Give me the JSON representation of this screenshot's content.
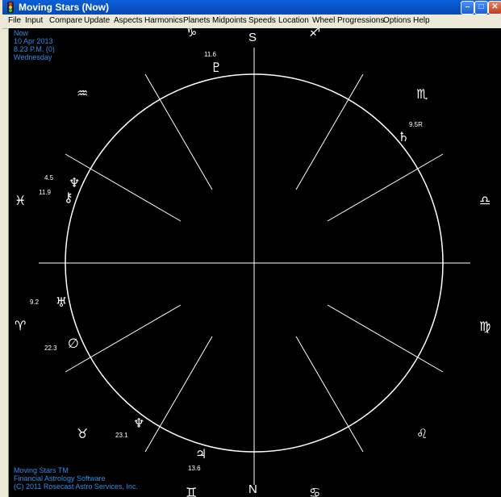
{
  "window": {
    "title": "Moving Stars (Now)",
    "minimize": "–",
    "maximize": "□",
    "close": "✕"
  },
  "menu": [
    "File",
    "Input",
    "Compare",
    "Update",
    "Aspects",
    "Harmonics",
    "Planets",
    "Midpoints",
    "Speeds",
    "Location",
    "Wheel",
    "Progressions",
    "Options",
    "Help"
  ],
  "info": {
    "line1": "Now",
    "line2": "10 Apr 2013",
    "line3": "8.23 P.M. (0)",
    "line4": "Wednesday"
  },
  "footer": {
    "line1": "Moving Stars TM",
    "line2": "Financial Astrology Software",
    "line3": "(C) 2011 Rosecast Astro Services, Inc."
  },
  "compass": {
    "top": "S",
    "bottom": "N"
  },
  "zodiac": {
    "capricorn": "♑",
    "sagittarius": "♐",
    "aquarius": "♒",
    "scorpio": "♏",
    "pisces": "♓",
    "libra": "♎",
    "aries": "♈",
    "virgo": "♍",
    "taurus": "♉",
    "leo": "♌",
    "gemini": "♊",
    "cancer": "♋"
  },
  "planets": {
    "pluto": {
      "glyph": "♇",
      "value": "11.6"
    },
    "saturn": {
      "glyph": "♄",
      "value": "9.5R"
    },
    "neptune": {
      "glyph": "♆",
      "value": "4.5"
    },
    "chiron": {
      "glyph": "⚷",
      "value": "11.9"
    },
    "uranus": {
      "glyph": "♅",
      "value": "9.2"
    },
    "node": {
      "glyph": "∅",
      "value": "22.3"
    },
    "neptune2": {
      "glyph": "♆",
      "value": "23.1"
    },
    "jupiter": {
      "glyph": "♃",
      "value": "13.6"
    }
  }
}
